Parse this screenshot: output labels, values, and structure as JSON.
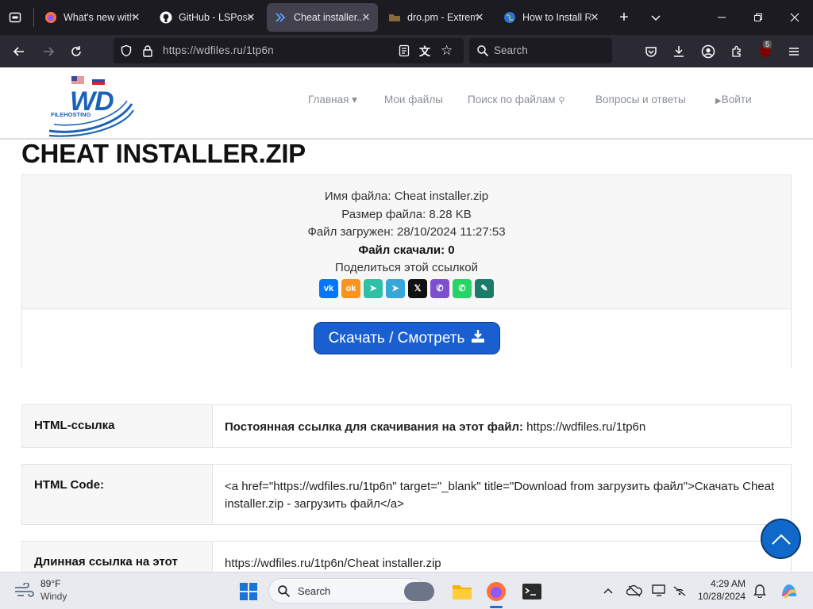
{
  "browser": {
    "tabs": [
      {
        "label": "What's new with",
        "icon": "firefox-icon"
      },
      {
        "label": "GitHub - LSPose",
        "icon": "github-icon"
      },
      {
        "label": "Cheat installer...",
        "icon": "wdfiles-icon",
        "active": true
      },
      {
        "label": "dro.pm - Extrem",
        "icon": "folder-icon"
      },
      {
        "label": "How to Install R",
        "icon": "globe-icon"
      }
    ],
    "url": "https://wdfiles.ru/1tp6n",
    "search_placeholder": "Search",
    "extension_badge": "5"
  },
  "site": {
    "logo_text": "WD",
    "logo_sub": "FILEHOSTING",
    "nav": [
      "Главная",
      "Мои файлы",
      "Поиск по файлам",
      "Вопросы и ответы",
      "Войти"
    ],
    "page_title": "CHEAT INSTALLER.ZIP",
    "file_info": {
      "name_label": "Имя файла:",
      "name": "Cheat installer.zip",
      "size_label": "Размер файла:",
      "size": "8.28 KB",
      "uploaded_label": "Файл загружен:",
      "uploaded": "28/10/2024 11:27:53",
      "downloads": "Файл скачали: 0",
      "share_label": "Поделиться этой ссылкой"
    },
    "share_icons": [
      "vk-icon",
      "odnoklassniki-icon",
      "sms-icon",
      "telegram-icon",
      "x-icon",
      "viber-icon",
      "whatsapp-icon",
      "link-icon"
    ],
    "download_button": "Скачать / Смотреть",
    "rows": [
      {
        "label": "HTML-ссылка",
        "bold": "Постоянная ссылка для скачивания на этот файл:",
        "value": " https://wdfiles.ru/1tp6n"
      },
      {
        "label": "HTML Code:",
        "value": "<a href=\"https://wdfiles.ru/1tp6n\" target=\"_blank\" title=\"Download from загрузить файл\">Скачать Cheat installer.zip - загрузить файл</a>"
      },
      {
        "label": "Длинная ссылка на этот",
        "value": "https://wdfiles.ru/1tp6n/Cheat installer.zip"
      }
    ]
  },
  "taskbar": {
    "weather_temp": "89°F",
    "weather_desc": "Windy",
    "search": "Search",
    "time": "4:29 AM",
    "date": "10/28/2024"
  }
}
